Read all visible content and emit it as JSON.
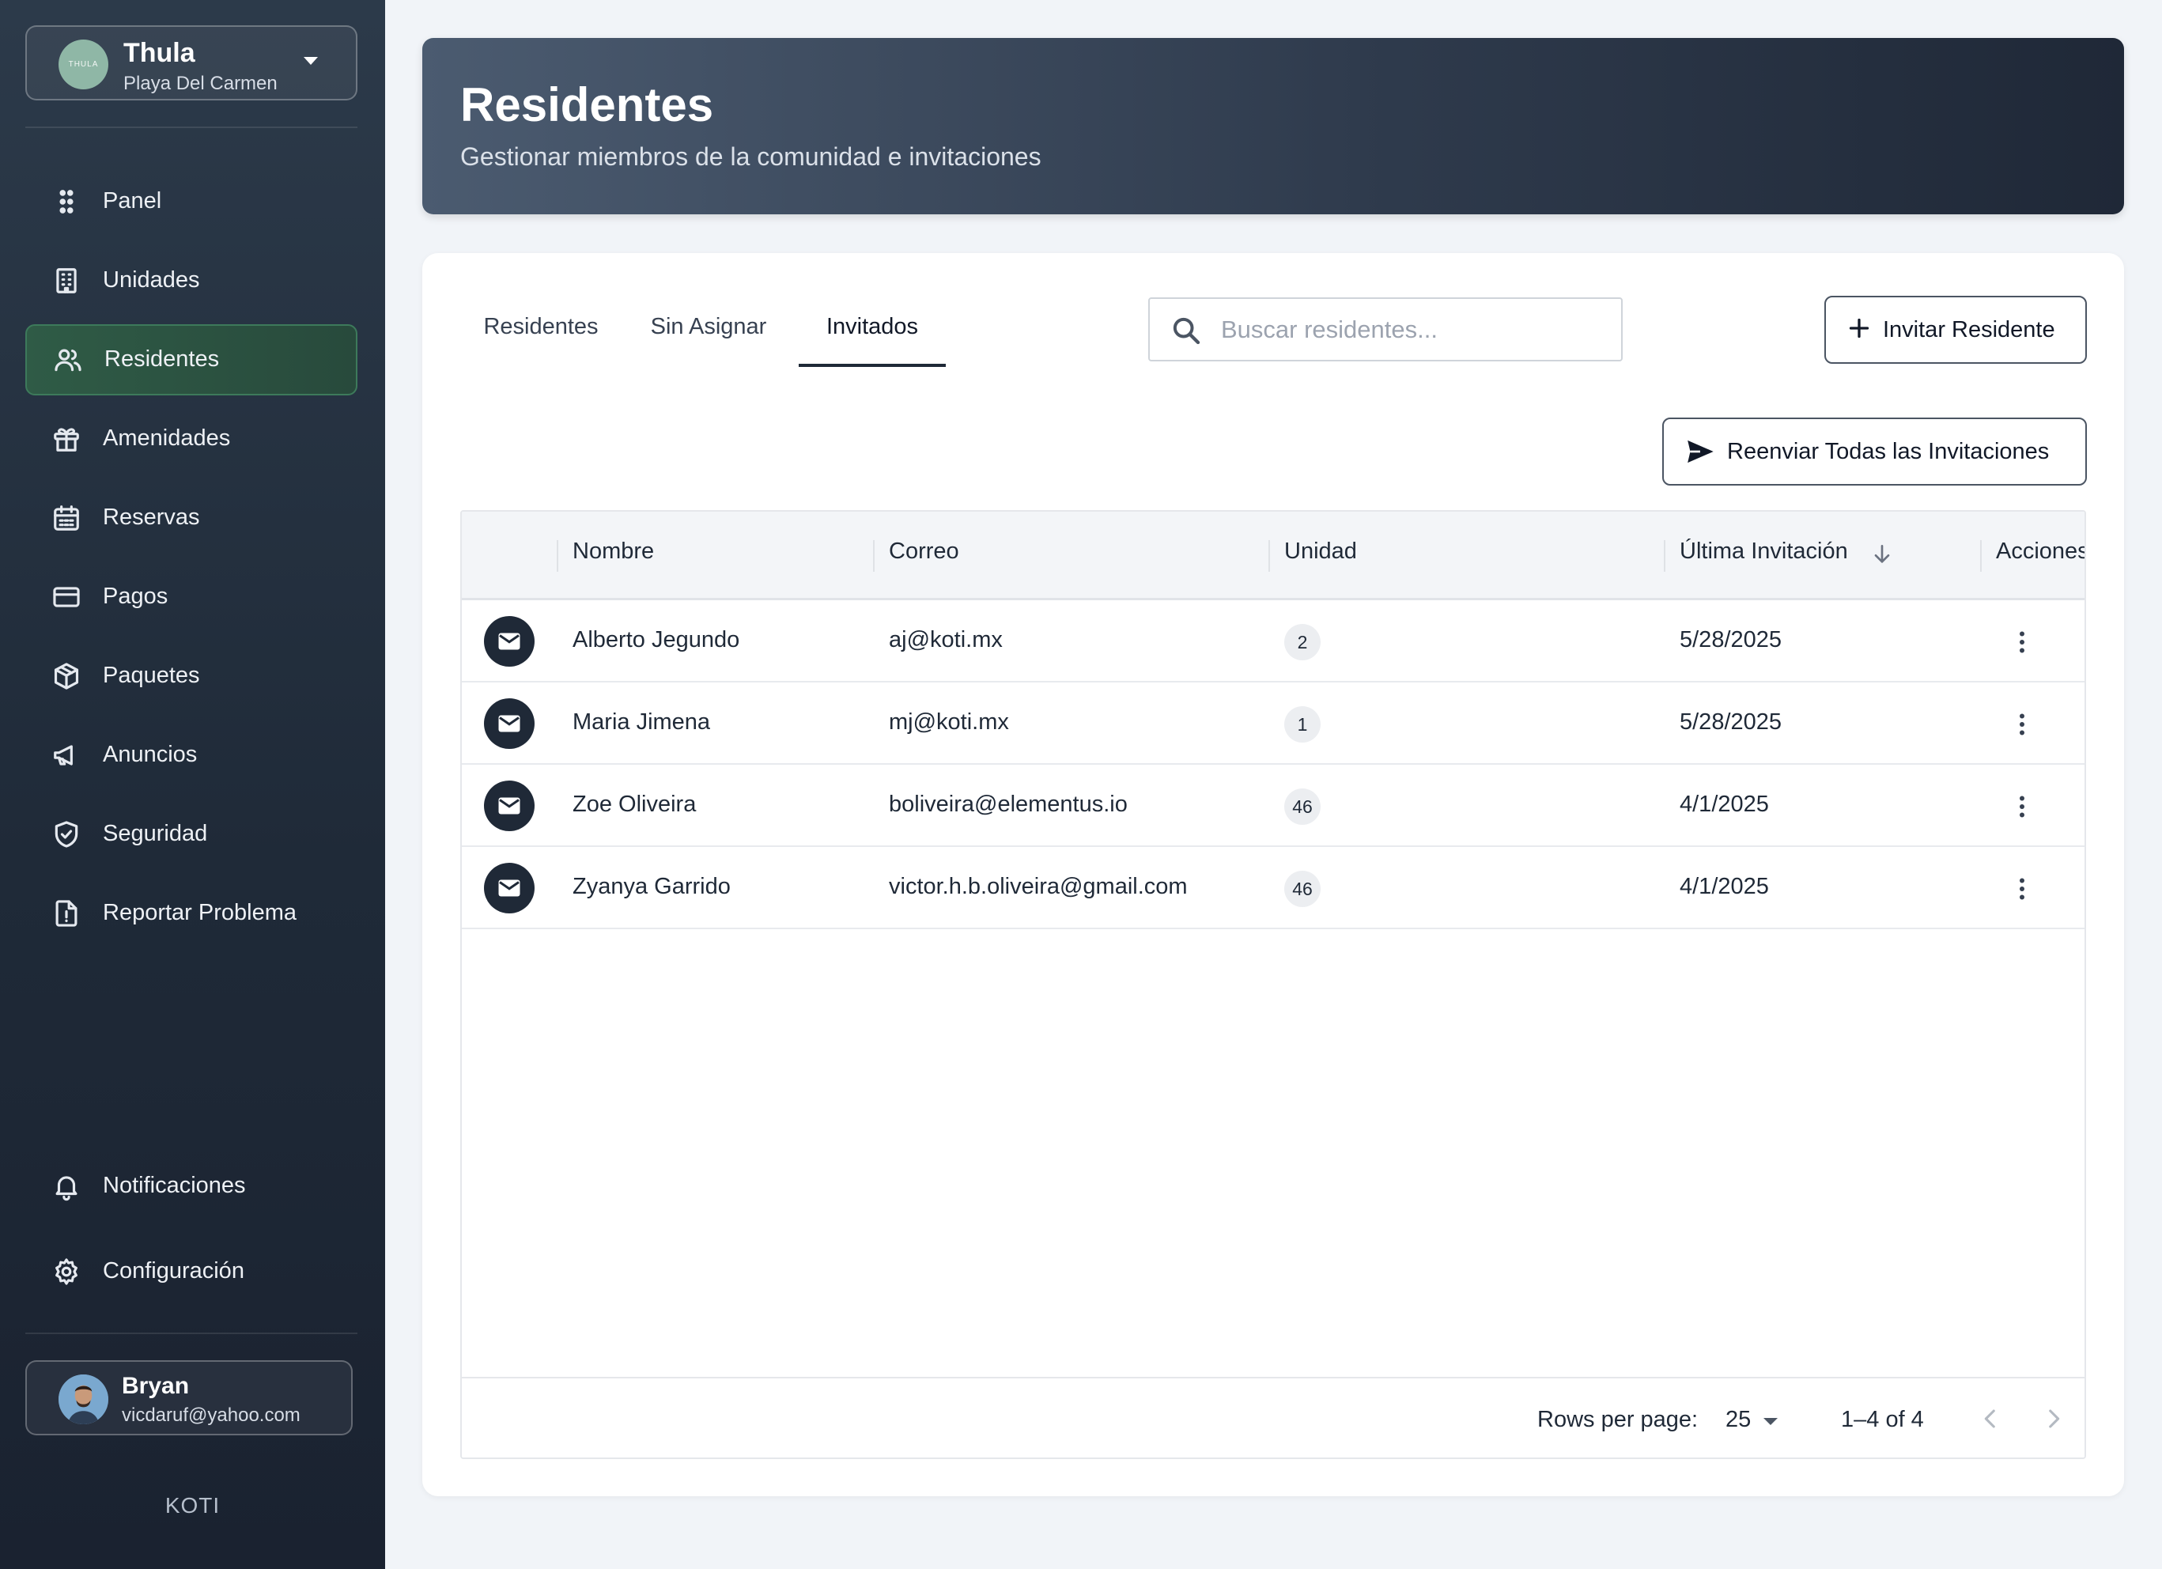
{
  "sidebar": {
    "org": {
      "name": "Thula",
      "location": "Playa Del Carmen",
      "logo_text": "THULA"
    },
    "nav": [
      {
        "label": "Panel",
        "icon": "grid-dots-icon"
      },
      {
        "label": "Unidades",
        "icon": "building-icon"
      },
      {
        "label": "Residentes",
        "icon": "users-icon",
        "active": true
      },
      {
        "label": "Amenidades",
        "icon": "gift-icon"
      },
      {
        "label": "Reservas",
        "icon": "calendar-icon"
      },
      {
        "label": "Pagos",
        "icon": "credit-card-icon"
      },
      {
        "label": "Paquetes",
        "icon": "package-icon"
      },
      {
        "label": "Anuncios",
        "icon": "megaphone-icon"
      },
      {
        "label": "Seguridad",
        "icon": "shield-check-icon"
      },
      {
        "label": "Reportar Problema",
        "icon": "report-icon"
      }
    ],
    "bottom_nav": [
      {
        "label": "Notificaciones",
        "icon": "bell-icon"
      },
      {
        "label": "Configuración",
        "icon": "gear-icon"
      }
    ],
    "user": {
      "name": "Bryan",
      "email": "vicdaruf@yahoo.com"
    },
    "brand": "KOTI"
  },
  "header": {
    "title": "Residentes",
    "subtitle": "Gestionar miembros de la comunidad e invitaciones"
  },
  "tabs": [
    {
      "label": "Residentes",
      "active": false
    },
    {
      "label": "Sin Asignar",
      "active": false
    },
    {
      "label": "Invitados",
      "active": true
    }
  ],
  "search": {
    "placeholder": "Buscar residentes...",
    "value": ""
  },
  "buttons": {
    "invite": "Invitar Residente",
    "resend_all": "Reenviar Todas las Invitaciones"
  },
  "table": {
    "columns": [
      "Nombre",
      "Correo",
      "Unidad",
      "Última Invitación",
      "Acciones"
    ],
    "sorted_column": "Última Invitación",
    "sort_direction": "desc",
    "rows": [
      {
        "name": "Alberto Jegundo",
        "email": "aj@koti.mx",
        "unit": "2",
        "last_invite": "5/28/2025"
      },
      {
        "name": "Maria Jimena",
        "email": "mj@koti.mx",
        "unit": "1",
        "last_invite": "5/28/2025"
      },
      {
        "name": "Zoe Oliveira",
        "email": "boliveira@elementus.io",
        "unit": "46",
        "last_invite": "4/1/2025"
      },
      {
        "name": "Zyanya Garrido",
        "email": "victor.h.b.oliveira@gmail.com",
        "unit": "46",
        "last_invite": "4/1/2025"
      }
    ]
  },
  "pagination": {
    "rows_per_page_label": "Rows per page:",
    "rows_per_page": "25",
    "range": "1–4 of 4"
  },
  "colors": {
    "sidebar_bg": "#1f2a38",
    "active_nav": "#2f5b46",
    "header_start": "#4b5b70",
    "header_end": "#1f2837",
    "page_bg": "#f1f4f8"
  }
}
